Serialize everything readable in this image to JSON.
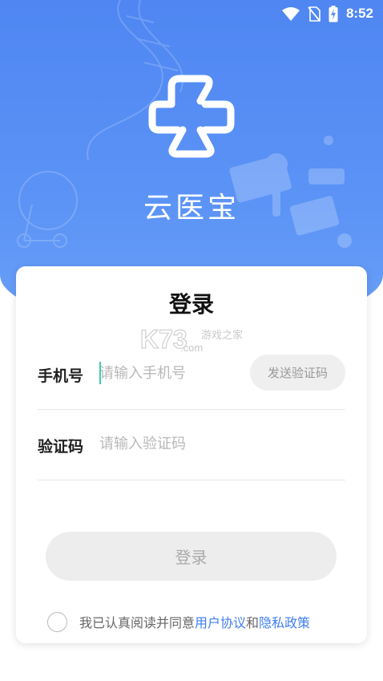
{
  "status_bar": {
    "time": "8:52",
    "icons": [
      "wifi-icon",
      "no-sim-icon",
      "battery-charging-icon"
    ]
  },
  "app": {
    "name": "云医宝",
    "logo_icon": "cross-clover-logo"
  },
  "watermark": {
    "brand": "K73",
    "sub_text": "游戏之家",
    "domain": ".com"
  },
  "login_card": {
    "title": "登录",
    "phone": {
      "label": "手机号",
      "placeholder": "请输入手机号",
      "value": ""
    },
    "code": {
      "label": "验证码",
      "placeholder": "请输入验证码",
      "value": ""
    },
    "send_code_button": "发送验证码",
    "login_button": "登录",
    "agreement": {
      "prefix": "我已认真阅读并同意",
      "user_agreement": "用户协议",
      "and": "和",
      "privacy_policy": "隐私政策",
      "checked": false
    }
  },
  "colors": {
    "header_blue": "#5b93f6",
    "link_blue": "#3f7ef0",
    "caret_teal": "#3cc9b2",
    "disabled_button": "#ededed"
  }
}
